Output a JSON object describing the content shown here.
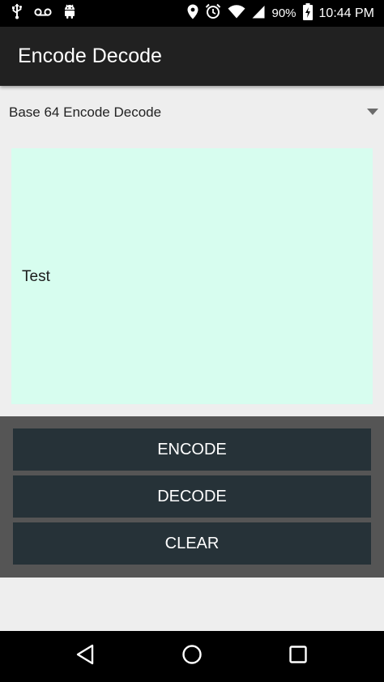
{
  "status_bar": {
    "icons_left": [
      "usb-icon",
      "voicemail-icon",
      "android-icon"
    ],
    "icons_right": [
      "location-icon",
      "alarm-icon",
      "wifi-icon",
      "signal-icon"
    ],
    "battery_percent": "90%",
    "time": "10:44 PM"
  },
  "app_bar": {
    "title": "Encode Decode"
  },
  "spinner": {
    "selected": "Base 64 Encode Decode"
  },
  "input": {
    "value": "Test"
  },
  "buttons": {
    "encode": "ENCODE",
    "decode": "DECODE",
    "clear": "CLEAR"
  },
  "nav_bar": {
    "icons": [
      "back-icon",
      "home-icon",
      "recents-icon"
    ]
  },
  "colors": {
    "app_bar": "#212121",
    "text_area": "#d7fdef",
    "button_panel": "#555555",
    "button": "#263238",
    "background": "#eeeeee"
  }
}
